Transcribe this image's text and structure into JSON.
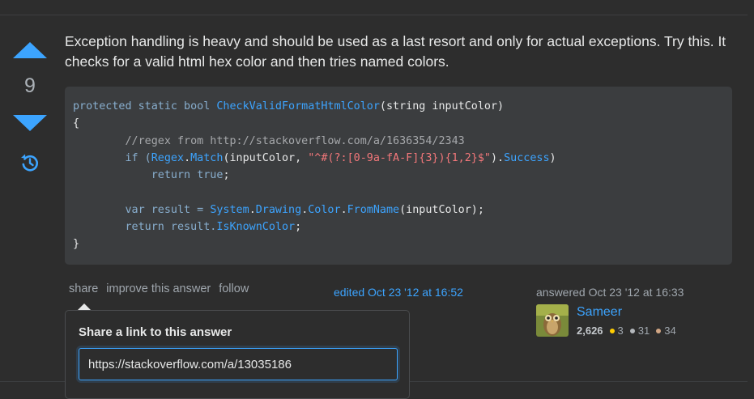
{
  "vote": {
    "score": "9"
  },
  "answer": {
    "text": "Exception handling is heavy and should be used as a last resort and only for actual exceptions. Try this. It checks for a valid html hex color and then tries named colors."
  },
  "code": {
    "l1": {
      "a": "protected static bool ",
      "b": "CheckValidFormatHtmlColor",
      "c": "(string inputColor)"
    },
    "l2": "{",
    "l3": "        //regex from http://stackoverflow.com/a/1636354/2343",
    "l4": {
      "a": "        if (",
      "b": "Regex",
      "c": ".",
      "d": "Match",
      "e": "(inputColor, ",
      "f": "\"^#(?:[0-9a-fA-F]{3}){1,2}$\"",
      "g": ").",
      "h": "Success",
      "i": ")"
    },
    "l5": {
      "a": "            return ",
      "b": "true",
      "c": ";"
    },
    "l7": {
      "a": "        var result = ",
      "b": "System",
      "c": ".",
      "d": "Drawing",
      "e": ".",
      "f": "Color",
      "g": ".",
      "h": "FromName",
      "i": "(inputColor);"
    },
    "l8": {
      "a": "        return result.",
      "b": "IsKnownColor",
      "c": ";"
    },
    "l9": "}"
  },
  "menu": {
    "share": "share",
    "improve": "improve this answer",
    "follow": "follow"
  },
  "edited": "edited Oct 23 '12 at 16:52",
  "answered": "answered Oct 23 '12 at 16:33",
  "user": {
    "name": "Sameer",
    "reputation": "2,626",
    "gold": "3",
    "silver": "31",
    "bronze": "34"
  },
  "share_popup": {
    "title": "Share a link to this answer",
    "url": "https://stackoverflow.com/a/13035186"
  },
  "colors": {
    "accent": "#3ca4ff",
    "gold": "#ffcc01",
    "silver": "#b4b8bc",
    "bronze": "#d1a684"
  }
}
